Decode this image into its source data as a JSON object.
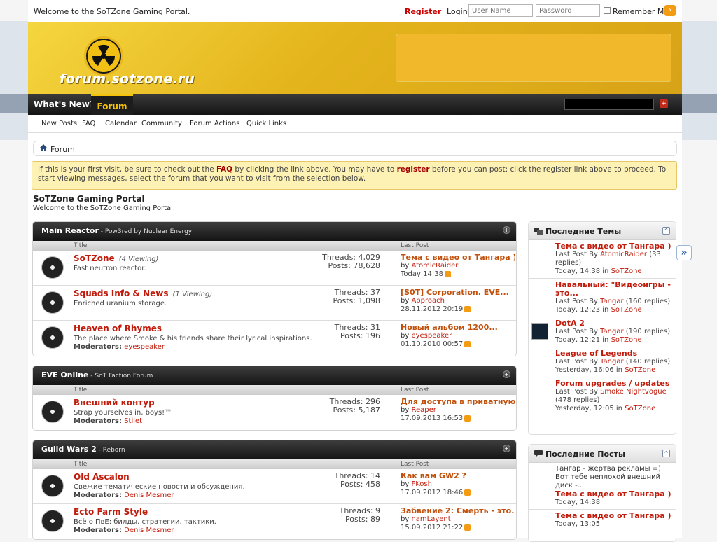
{
  "topbar": {
    "welcome": "Welcome to the SoTZone Gaming Portal.",
    "register": "Register",
    "login_label": "Login:",
    "username_placeholder": "User Name",
    "password_placeholder": "Password",
    "remember_label": "Remember Me?"
  },
  "banner": {
    "logo_text": "forum.sotzone.ru"
  },
  "nav": {
    "whats_new": "What's New?",
    "forum": "Forum",
    "sub": [
      "New Posts",
      "FAQ",
      "Calendar",
      "Community",
      "Forum Actions",
      "Quick Links"
    ]
  },
  "breadcrumb": {
    "label": "Forum"
  },
  "notice": {
    "part1": "If this is your first visit, be sure to check out the ",
    "faq": "FAQ",
    "part2": " by clicking the link above. You may have to ",
    "register": "register",
    "part3": " before you can post: click the register link above to proceed. To start viewing messages, select the forum that you want to visit from the selection below."
  },
  "site": {
    "title": "SoTZone Gaming Portal",
    "desc": "Welcome to the SoTZone Gaming Portal."
  },
  "col_heads": {
    "title": "Title",
    "last_post": "Last Post"
  },
  "categories": [
    {
      "name": "Main Reactor",
      "sub": " - Pow3red by Nuclear Energy",
      "forums": [
        {
          "name": "SoTZone",
          "viewing": "(4 Viewing)",
          "desc": "Fast neutron reactor.",
          "mods_label": "",
          "mods": "",
          "threads": "Threads: 4,029",
          "posts": "Posts: 78,628",
          "last_title": "Тема с видео от Тангара )",
          "last_by_label": "by ",
          "last_by": "AtomicRaider",
          "last_date": "Today 14:38"
        },
        {
          "name": "Squads Info & News",
          "viewing": "(1 Viewing)",
          "desc": "Enriched uranium storage.",
          "mods_label": "",
          "mods": "",
          "threads": "Threads: 37",
          "posts": "Posts: 1,098",
          "last_title": "[S0T] Corporation. EVE...",
          "last_by_label": "by ",
          "last_by": "Approach",
          "last_date": "28.11.2012 20:19"
        },
        {
          "name": "Heaven of Rhymes",
          "viewing": "",
          "desc": "The place where Smoke & his friends share their lyrical inspirations.",
          "mods_label": "Moderators:",
          "mods": "eyespeaker",
          "threads": "Threads: 31",
          "posts": "Posts: 196",
          "last_title": "Новый альбом 1200...",
          "last_by_label": "by ",
          "last_by": "eyespeaker",
          "last_date": "01.10.2010 00:57"
        }
      ]
    },
    {
      "name": "EVE Online",
      "sub": " - SoT Faction Forum",
      "forums": [
        {
          "name": "Внешний контур",
          "viewing": "",
          "desc": "Strap yourselves in, boys!™",
          "mods_label": "Moderators:",
          "mods": "Stilet",
          "threads": "Threads: 296",
          "posts": "Posts: 5,187",
          "last_title": "Для доступа в приватную...",
          "last_by_label": "by ",
          "last_by": "Reaper",
          "last_date": "17.09.2013 16:53"
        }
      ]
    },
    {
      "name": "Guild Wars 2",
      "sub": " - Reborn",
      "forums": [
        {
          "name": "Old Ascalon",
          "viewing": "",
          "desc": "Свежие тематические новости и обсуждения.",
          "mods_label": "Moderators:",
          "mods": "Denis Mesmer",
          "threads": "Threads: 14",
          "posts": "Posts: 458",
          "last_title": "Как вам GW2 ?",
          "last_by_label": "by ",
          "last_by": "FKosh",
          "last_date": "17.09.2012 18:46"
        },
        {
          "name": "Ecto Farm Style",
          "viewing": "",
          "desc": "Всё о ПвЕ: билды, стратегии, тактики.",
          "mods_label": "Moderators:",
          "mods": "Denis Mesmer",
          "threads": "Threads: 9",
          "posts": "Posts: 89",
          "last_title": "Забвение 2: Смерть - это...",
          "last_by_label": "by ",
          "last_by": "namLayent",
          "last_date": "15.09.2012 21:22"
        }
      ]
    }
  ],
  "sidebar": {
    "threads_title": "Последние Темы",
    "threads": [
      {
        "title": "Тема с видео от Тангара )",
        "meta": "Last Post By ",
        "by": "AtomicRaider",
        "extra": " (33 replies)",
        "when": "Today, 14:38 in ",
        "where": "SoTZone"
      },
      {
        "title": "Навальный: \"Видеоигры - это...",
        "meta": "Last Post By ",
        "by": "Tangar",
        "extra": " (160 replies)",
        "when": "Today, 12:23 in ",
        "where": "SoTZone"
      },
      {
        "title": "DotA 2",
        "meta": "Last Post By ",
        "by": "Tangar",
        "extra": " (190 replies)",
        "when": "Today, 12:21 in ",
        "where": "SoTZone"
      },
      {
        "title": "League of Legends",
        "meta": "Last Post By ",
        "by": "Tangar",
        "extra": " (140 replies)",
        "when": "Yesterday, 16:06 in ",
        "where": "SoTZone"
      },
      {
        "title": "Forum upgrades / updates",
        "meta": "Last Post By ",
        "by": "Smoke Nightvogue",
        "extra": " (478 replies)",
        "when": "Yesterday, 12:05 in ",
        "where": "SoTZone"
      }
    ],
    "posts_title": "Последние Посты",
    "posts": [
      {
        "body": "Тангар - жертва рекламы =) Вот тебе неплохой внешний диск -...",
        "title": "Тема с видео от Тангара )",
        "when": "Today, 14:38"
      },
      {
        "body": "",
        "title": "Тема с видео от Тангара )",
        "when": "Today, 13:05"
      }
    ]
  }
}
